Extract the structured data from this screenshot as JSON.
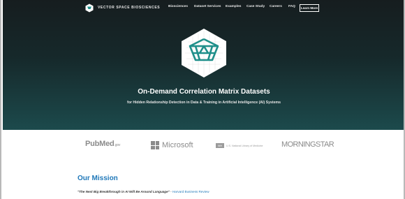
{
  "brand": {
    "name": "VECTOR SPACE BIOSCIENCES"
  },
  "nav": {
    "items": [
      "Biosciences",
      "Dataset Services",
      "Examples",
      "Case Study",
      "Careers",
      "FAQ"
    ],
    "cta_label": "Learn More"
  },
  "hero": {
    "title": "On-Demand Correlation Matrix Datasets",
    "subtitle": "for Hidden Relationship Detection in Data & Training in Artificial Intelligence (AI) Systems"
  },
  "partner_logos": {
    "pubmed": {
      "main": "PubMed",
      "suffix": ".gov"
    },
    "microsoft": "Microsoft",
    "nlm": {
      "badge": "NIH",
      "name": "U.S. National Library of Medicine"
    },
    "morningstar": "MORNINGSTAR"
  },
  "mission": {
    "title": "Our Mission",
    "quote": "\"The Next Big Breakthrough in AI Will Be Around Language\"",
    "separator": " - ",
    "source": "Harvard Business Review"
  },
  "colors": {
    "hero_top": "#161d1f",
    "hero_bottom": "#1c4a4c",
    "accent_teal": "#1f8f8a",
    "link_blue": "#1f78b9"
  }
}
